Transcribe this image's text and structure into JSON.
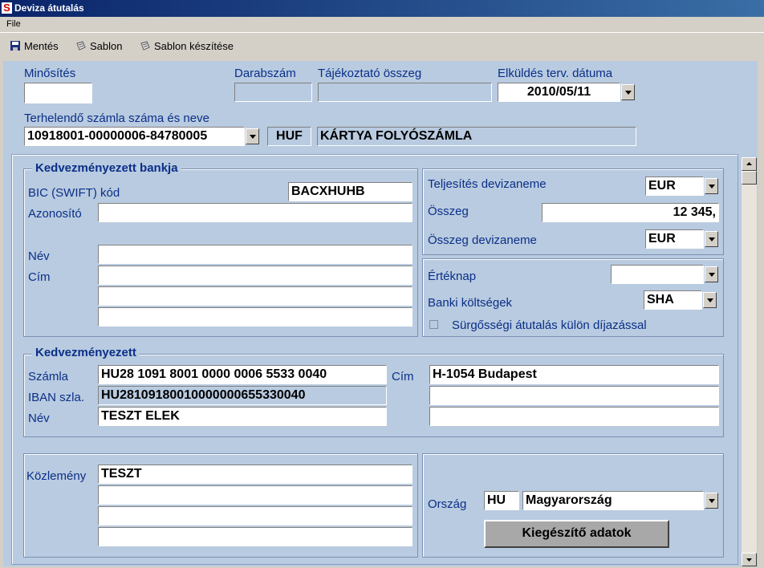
{
  "window": {
    "title": "Deviza átutalás",
    "icon_letter": "S"
  },
  "menu": {
    "file": "File"
  },
  "toolbar": {
    "save": "Mentés",
    "template": "Sablon",
    "create_template": "Sablon készítése"
  },
  "header": {
    "minosites_label": "Minősítés",
    "minosites_value": "",
    "darabszam_label": "Darabszám",
    "darabszam_value": "",
    "tajekoztato_label": "Tájékoztató összeg",
    "tajekoztato_value": "",
    "send_date_label": "Elküldés terv. dátuma",
    "send_date_value": "2010/05/11",
    "account_label": "Terhelendő számla száma és neve",
    "account_value": "10918001-00000006-84780005",
    "account_currency": "HUF",
    "account_name": "KÁRTYA FOLYÓSZÁMLA"
  },
  "beneficiary_bank": {
    "title": "Kedvezményezett bankja",
    "bic_label": "BIC (SWIFT) kód",
    "bic_value": "BACXHUHB",
    "id_label": "Azonosító",
    "id_value": "",
    "name_label": "Név",
    "name_value": "",
    "address_label": "Cím",
    "address_lines": [
      "",
      "",
      ""
    ]
  },
  "payment": {
    "perf_currency_label": "Teljesítés devizaneme",
    "perf_currency_value": "EUR",
    "amount_label": "Összeg",
    "amount_value": "12 345,",
    "amount_currency_label": "Összeg devizaneme",
    "amount_currency_value": "EUR"
  },
  "options": {
    "value_date_label": "Értéknap",
    "value_date_value": "",
    "bank_costs_label": "Banki költségek",
    "bank_costs_value": "SHA",
    "urgent_label": "Sürgősségi átutalás külön díjazással"
  },
  "beneficiary": {
    "title": "Kedvezményezett",
    "account_label": "Számla",
    "account_value": "HU28 1091 8001 0000 0006 5533 0040",
    "iban_label": "IBAN szla.",
    "iban_value": "HU28109180010000000655330040",
    "name_label": "Név",
    "name_value": "TESZT ELEK",
    "address_label": "Cím",
    "address_lines": [
      "H-1054 Budapest",
      "",
      ""
    ]
  },
  "remittance": {
    "label": "Közlemény",
    "lines": [
      "TESZT",
      "",
      "",
      ""
    ]
  },
  "country": {
    "label": "Ország",
    "code": "HU",
    "name": "Magyarország"
  },
  "extra_button": "Kiegészítő adatok"
}
